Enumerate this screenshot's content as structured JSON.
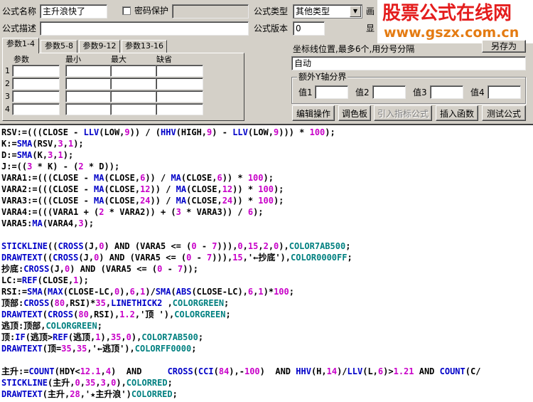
{
  "form": {
    "name_label": "公式名称",
    "name_value": "主升浪快了",
    "password_label": "密码保护",
    "password_checked": false,
    "type_label": "公式类型",
    "type_value": "其他类型",
    "desc_label": "公式描述",
    "desc_value": "",
    "version_label": "公式版本",
    "version_value": "0",
    "cut_label_1": "画",
    "cut_label_2": "显"
  },
  "tabs": [
    {
      "label": "参数1-4",
      "active": true
    },
    {
      "label": "参数5-8",
      "active": false
    },
    {
      "label": "参数9-12",
      "active": false
    },
    {
      "label": "参数13-16",
      "active": false
    }
  ],
  "params": {
    "headers": [
      "参数",
      "最小",
      "最大",
      "缺省"
    ],
    "rows": [
      "1",
      "2",
      "3",
      "4"
    ]
  },
  "coords": {
    "label": "坐标线位置,最多6个,用分号分隔",
    "value": "自动",
    "save_as": "另存为"
  },
  "yaxis": {
    "label": "额外Y轴分界",
    "values": [
      "值1",
      "值2",
      "值3",
      "值4"
    ]
  },
  "buttons": [
    "编辑操作",
    "调色板",
    "引入指标公式",
    "插入函数",
    "测试公式"
  ],
  "watermark": {
    "line1": "股票公式在线网",
    "line2": "www.gszx.com.cn"
  },
  "code_lines": [
    "RSV:=(((CLOSE - LLV(LOW,9)) / (HHV(HIGH,9) - LLV(LOW,9))) * 100);",
    "K:=SMA(RSV,3,1);",
    "D:=SMA(K,3,1);",
    "J:=((3 * K) - (2 * D));",
    "VARA1:=(((CLOSE - MA(CLOSE,6)) / MA(CLOSE,6)) * 100);",
    "VARA2:=(((CLOSE - MA(CLOSE,12)) / MA(CLOSE,12)) * 100);",
    "VARA3:=(((CLOSE - MA(CLOSE,24)) / MA(CLOSE,24)) * 100);",
    "VARA4:=(((VARA1 + (2 * VARA2)) + (3 * VARA3)) / 6);",
    "VARA5:MA(VARA4,3);",
    "",
    "STICKLINE((CROSS(J,0) AND (VARA5 <= (0 - 7))),0,15,2,0),COLOR7AB500;",
    "DRAWTEXT((CROSS(J,0) AND (VARA5 <= (0 - 7))),15,'←抄底'),COLOR0000FF;",
    "抄底:CROSS(J,0) AND (VARA5 <= (0 - 7));",
    "LC:=REF(CLOSE,1);",
    "RSI:=SMA(MAX(CLOSE-LC,0),6,1)/SMA(ABS(CLOSE-LC),6,1)*100;",
    "顶部:CROSS(80,RSI)*35,LINETHICK2 ,COLORGREEN;",
    "DRAWTEXT(CROSS(80,RSI),1.2,'顶 '),COLORGREEN;",
    "逃顶:顶部,COLORGREEN;",
    "顶:IF(逃顶>REF(逃顶,1),35,0),COLOR7AB500;",
    "DRAWTEXT(顶=35,35,'←逃顶'),COLORFF0000;",
    "",
    "主升:=COUNT(HDY<12.1,4)  AND     CROSS(CCI(84),-100)  AND HHV(H,14)/LLV(L,6)>1.21 AND COUNT(C/",
    "STICKLINE(主升,0,35,3,0),COLORRED;",
    "DRAWTEXT(主升,28,'★主升浪')COLORRED;"
  ]
}
